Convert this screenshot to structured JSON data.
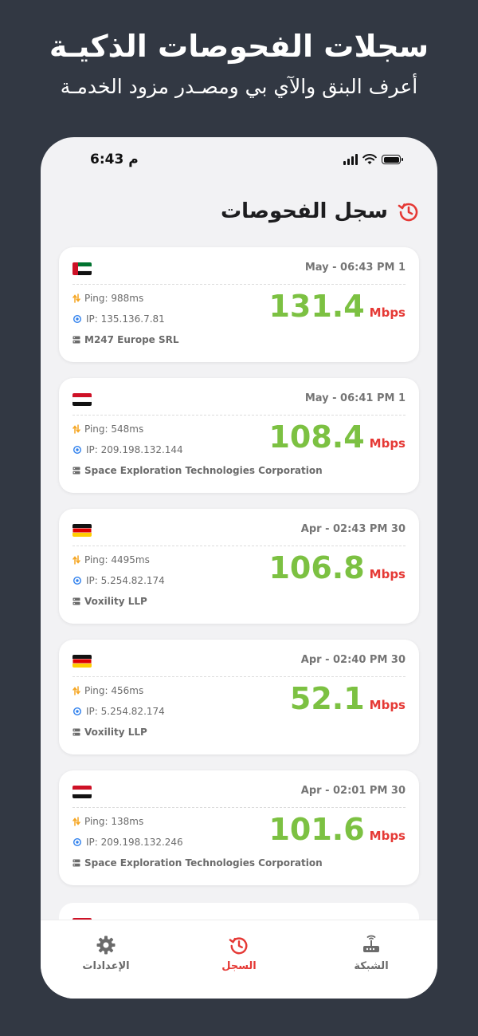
{
  "promo": {
    "title": "سجلات الفحوصات الذكيـة",
    "subtitle": "أعرف البنق والآي بي ومصـدر مزود الخدمـة"
  },
  "status_bar": {
    "time": "6:43 م"
  },
  "header": {
    "title": "سجل الفحوصات",
    "icon": "history-icon"
  },
  "colors": {
    "speed": "#7cc142",
    "unit": "#e53935",
    "accent": "#e53935",
    "background": "#323843"
  },
  "records": [
    {
      "date": "May - 06:43 PM 1",
      "flag": "ae",
      "ping": "Ping: 988ms",
      "ip": "IP: 135.136.7.81",
      "isp": "M247 Europe SRL",
      "speed": "131.4",
      "unit": "Mbps"
    },
    {
      "date": "May - 06:41 PM 1",
      "flag": "ye",
      "ping": "Ping: 548ms",
      "ip": "IP: 209.198.132.144",
      "isp": "Space Exploration Technologies Corporation",
      "speed": "108.4",
      "unit": "Mbps"
    },
    {
      "date": "Apr - 02:43 PM 30",
      "flag": "de",
      "ping": "Ping: 4495ms",
      "ip": "IP: 5.254.82.174",
      "isp": "Voxility LLP",
      "speed": "106.8",
      "unit": "Mbps"
    },
    {
      "date": "Apr - 02:40 PM 30",
      "flag": "de",
      "ping": "Ping: 456ms",
      "ip": "IP: 5.254.82.174",
      "isp": "Voxility LLP",
      "speed": "52.1",
      "unit": "Mbps"
    },
    {
      "date": "Apr - 02:01 PM 30",
      "flag": "ye",
      "ping": "Ping: 138ms",
      "ip": "IP: 209.198.132.246",
      "isp": "Space Exploration Technologies Corporation",
      "speed": "101.6",
      "unit": "Mbps"
    }
  ],
  "tabs": {
    "settings": {
      "label": "الإعدادات",
      "icon": "gear-icon"
    },
    "history": {
      "label": "السجل",
      "icon": "history-icon",
      "active": true
    },
    "network": {
      "label": "الشبكة",
      "icon": "router-icon"
    }
  }
}
